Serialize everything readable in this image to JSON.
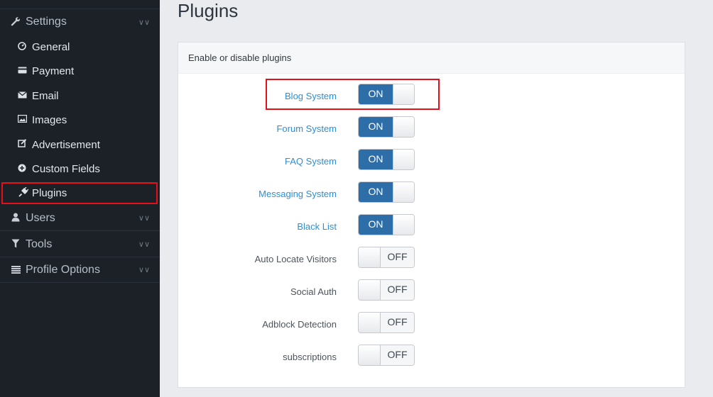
{
  "page": {
    "title": "Plugins"
  },
  "sidebar": {
    "sections": [
      {
        "label": "Settings",
        "icon": "wrench-icon"
      },
      {
        "label": "Users",
        "icon": "user-icon"
      },
      {
        "label": "Tools",
        "icon": "filter-icon"
      },
      {
        "label": "Profile Options",
        "icon": "list-icon"
      }
    ],
    "items": [
      {
        "label": "General",
        "icon": "dashboard-icon"
      },
      {
        "label": "Payment",
        "icon": "credit-card-icon"
      },
      {
        "label": "Email",
        "icon": "envelope-icon"
      },
      {
        "label": "Images",
        "icon": "image-icon"
      },
      {
        "label": "Advertisement",
        "icon": "edit-icon"
      },
      {
        "label": "Custom Fields",
        "icon": "plus-circle-icon"
      },
      {
        "label": "Plugins",
        "icon": "plug-icon",
        "active": true
      }
    ]
  },
  "panel": {
    "heading": "Enable or disable plugins",
    "on_label": "ON",
    "off_label": "OFF",
    "plugins": [
      {
        "name": "Blog System",
        "state": "ON",
        "enabled": true
      },
      {
        "name": "Forum System",
        "state": "ON",
        "enabled": true
      },
      {
        "name": "FAQ System",
        "state": "ON",
        "enabled": true
      },
      {
        "name": "Messaging System",
        "state": "ON",
        "enabled": true
      },
      {
        "name": "Black List",
        "state": "ON",
        "enabled": true
      },
      {
        "name": "Auto Locate Visitors",
        "state": "OFF",
        "enabled": false
      },
      {
        "name": "Social Auth",
        "state": "OFF",
        "enabled": false
      },
      {
        "name": "Adblock Detection",
        "state": "OFF",
        "enabled": false
      },
      {
        "name": "subscriptions",
        "state": "OFF",
        "enabled": false
      }
    ]
  },
  "colors": {
    "sidebar_bg": "#1c2128",
    "toggle_on": "#2e6ea8",
    "link": "#2a8fd6",
    "highlight": "#e5101a"
  }
}
